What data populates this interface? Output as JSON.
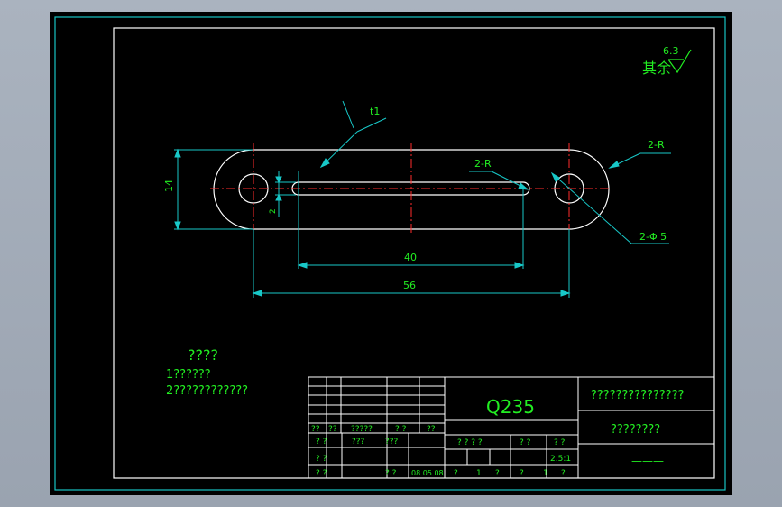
{
  "theme": {
    "frame": "#17c3c3",
    "outline": "#ffffff",
    "center": "#ff2d2d",
    "dim": "#18c8c8",
    "text": "#22ee22",
    "canvas": "#000000"
  },
  "drawing": {
    "thickness_label": "t1",
    "dim_height": "14",
    "dim_slot_width": "2",
    "dim_slot_length": "40",
    "dim_overall": "56",
    "leader_slot_radius": "2-R",
    "leader_end_radius": "2-R",
    "leader_holes": "2-Φ 5",
    "roughness_prefix": "其余",
    "roughness_value": "6.3"
  },
  "notes": {
    "heading": "????",
    "line1": "1??????",
    "line2": "2????????????"
  },
  "title_block": {
    "left_header": [
      "??",
      "??",
      "?????",
      "? ?",
      "??"
    ],
    "left_row1": [
      "? ?",
      "???",
      "???"
    ],
    "left_row2": [
      "? ?"
    ],
    "left_row3": [
      "? ?",
      "? ?",
      "08.05.08"
    ],
    "material": "Q235",
    "scale_headers": [
      "? ? ? ?",
      "? ?",
      "? ?"
    ],
    "scale_value": "2.5:1",
    "sheet_row": [
      "?",
      "1",
      "?",
      "?",
      "1",
      "?"
    ],
    "company": "???????????????",
    "part_name": "????????",
    "drawing_number": "———"
  }
}
